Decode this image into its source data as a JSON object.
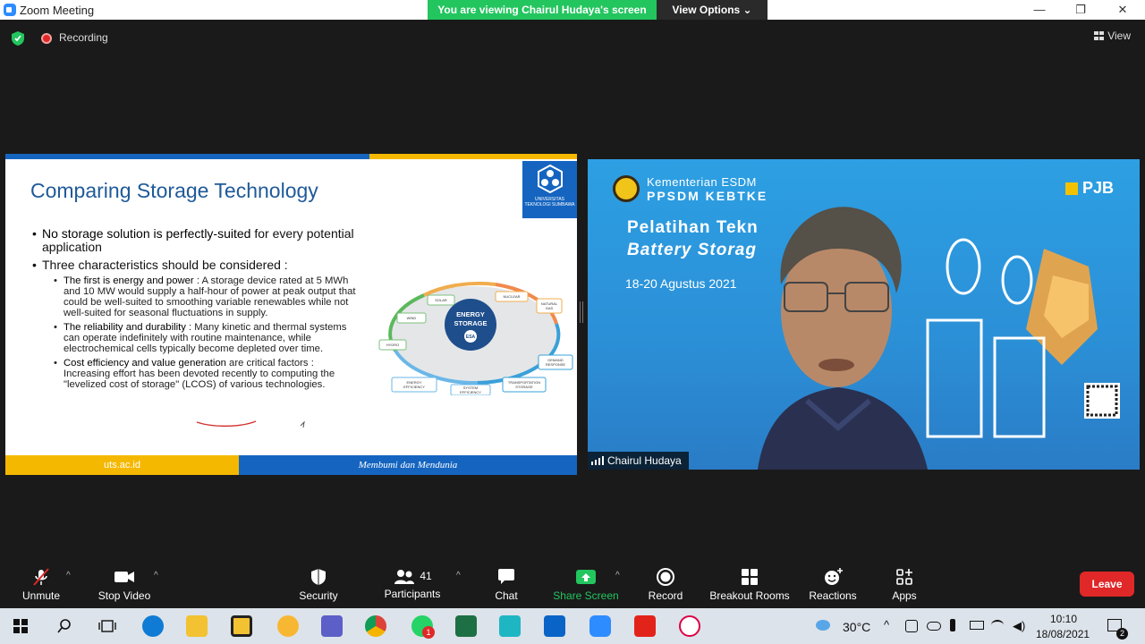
{
  "window": {
    "title": "Zoom Meeting",
    "controls": [
      "—",
      "❐",
      "✕"
    ]
  },
  "banner": {
    "viewing": "You are viewing Chairul Hudaya's screen",
    "view_options": "View Options ⌄"
  },
  "meeting": {
    "recording_label": "Recording",
    "view_label": "View"
  },
  "slide": {
    "title": "Comparing Storage Technology",
    "logo_text": "UNIVERSITAS TEKNOLOGI SUMBAWA",
    "bullet1_bold": "No storage solution is perfectly-suited",
    "bullet1_rest": " for every potential application",
    "bullet2": "Three characteristics should be considered :",
    "sub1_head": "The first is energy and power",
    "sub1_rest": " : A storage device rated at 5 MWh and 10 MW would supply a half-hour of power at peak output that could be well-suited to smoothing variable renewables while not well-suited for seasonal fluctuations in supply.",
    "sub2_head": "The reliability and durability",
    "sub2_rest": " : Many kinetic and thermal systems can operate indefinitely with routine maintenance, while electrochemical cells typically become depleted over time.",
    "sub3_head": "Cost efficiency and value generation",
    "sub3_rest": " are critical factors : Increasing effort has been devoted recently to computing the \"levelized cost of storage\" (LCOS) of various technologies.",
    "footer_left": "uts.ac.id",
    "footer_right": "Membumi dan Mendunia",
    "diagram": {
      "center": "ENERGY STORAGE",
      "badge": "ESA",
      "nodes": [
        "SOLAR",
        "NUCLEAR",
        "NATURAL GAS",
        "WIND",
        "HYDRO",
        "DEMAND RESPONSE",
        "TRANSPORTATION STORAGE",
        "SYSTEM EFFICIENCY",
        "ENERGY EFFICIENCY"
      ]
    }
  },
  "video": {
    "brand_line1": "Kementerian ESDM",
    "brand_line2": "PPSDM KEBTKE",
    "title_line1": "Pelatihan Tekn",
    "title_line2": "Battery Storag",
    "dates": "18-20 Agustus 2021",
    "sponsor": "PJB",
    "participant_name": "Chairul Hudaya"
  },
  "toolbar": {
    "unmute": "Unmute",
    "stop_video": "Stop Video",
    "security": "Security",
    "participants": "Participants",
    "participants_count": "41",
    "chat": "Chat",
    "share_screen": "Share Screen",
    "record": "Record",
    "breakout_rooms": "Breakout Rooms",
    "reactions": "Reactions",
    "apps": "Apps",
    "leave": "Leave"
  },
  "taskbar": {
    "temperature": "30°C",
    "time": "10:10",
    "date": "18/08/2021",
    "whatsapp_badge": "1",
    "notification_badge": "2"
  },
  "colors": {
    "banner_green": "#23c55e",
    "leave_red": "#e02828",
    "slide_blue": "#1565c0",
    "slide_yellow": "#f5b800",
    "share_green": "#23c55e"
  }
}
